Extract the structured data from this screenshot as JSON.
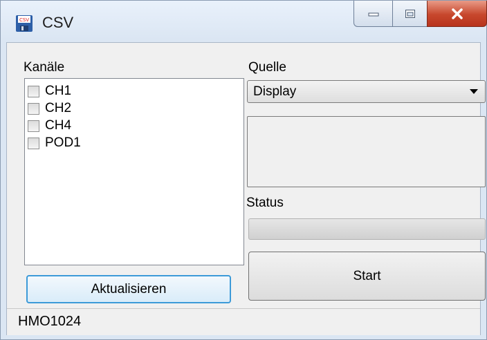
{
  "window": {
    "title": "CSV",
    "app_icon": "csv-floppy-icon",
    "buttons": {
      "minimize": "minimize-icon",
      "maximize": "maximize-icon",
      "close": "close-icon"
    }
  },
  "channels": {
    "label": "Kanäle",
    "items": [
      {
        "label": "CH1",
        "checked": false
      },
      {
        "label": "CH2",
        "checked": false
      },
      {
        "label": "CH4",
        "checked": false
      },
      {
        "label": "POD1",
        "checked": false
      }
    ],
    "refresh_button": "Aktualisieren"
  },
  "source": {
    "label": "Quelle",
    "selected": "Display"
  },
  "status": {
    "label": "Status",
    "progress": 0
  },
  "start_button": "Start",
  "statusbar": {
    "device": "HMO1024"
  },
  "colors": {
    "accent_border": "#3c9ad8",
    "close_button": "#c7472c",
    "title_bar": "#dbe6f3"
  }
}
